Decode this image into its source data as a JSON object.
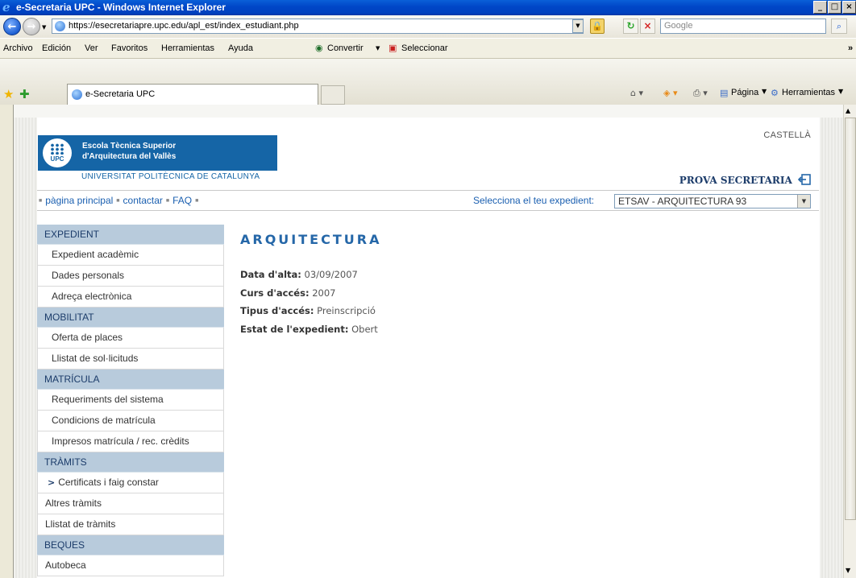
{
  "window": {
    "title": "e-Secretaria UPC - Windows Internet Explorer",
    "minimize": "_",
    "maximize": "□",
    "close": "×"
  },
  "browser": {
    "url": "https://esecretariapre.upc.edu/apl_est/index_estudiant.php",
    "search_placeholder": "Google",
    "menu": [
      "Archivo",
      "Edición",
      "Ver",
      "Favoritos",
      "Herramientas",
      "Ayuda"
    ],
    "convertir_label": "Convertir",
    "seleccionar_label": "Seleccionar",
    "tab_title": "e-Secretaria UPC",
    "page_label": "Página",
    "tools_label": "Herramientas"
  },
  "header": {
    "school_line1": "Escola Tècnica Superior",
    "school_line2": "d'Arquitectura del Vallès",
    "university": "UNIVERSITAT POLITÈCNICA DE CATALUNYA",
    "logo_text": "UPC",
    "language_link": "CASTELLÀ",
    "user_name": "PROVA SECRETARIA"
  },
  "topnav": {
    "links": [
      "pàgina principal",
      "contactar",
      "FAQ"
    ],
    "expedient_label": "Selecciona el teu expedient:",
    "expedient_value": "ETSAV - ARQUITECTURA 93"
  },
  "sidebar": {
    "sections": [
      {
        "title": "EXPEDIENT",
        "items": [
          "Expedient acadèmic",
          "Dades personals",
          "Adreça electrònica"
        ]
      },
      {
        "title": "MOBILITAT",
        "items": [
          "Oferta de places",
          "Llistat de sol·licituds"
        ]
      },
      {
        "title": "MATRÍCULA",
        "items": [
          "Requeriments del sistema",
          "Condicions de matrícula",
          "Impresos matrícula / rec. crèdits"
        ]
      },
      {
        "title": "TRÀMITS",
        "items": [
          "Certificats i faig constar",
          "Altres tràmits",
          "Llistat de tràmits"
        ]
      },
      {
        "title": "BEQUES",
        "items": [
          "Autobeca"
        ]
      }
    ]
  },
  "main": {
    "title": "ARQUITECTURA",
    "fields": [
      {
        "label": "Data d'alta:",
        "value": "03/09/2007"
      },
      {
        "label": "Curs d'accés:",
        "value": "2007"
      },
      {
        "label": "Tipus d'accés:",
        "value": "Preinscripció"
      },
      {
        "label": "Estat de l'expedient:",
        "value": "Obert"
      }
    ]
  }
}
